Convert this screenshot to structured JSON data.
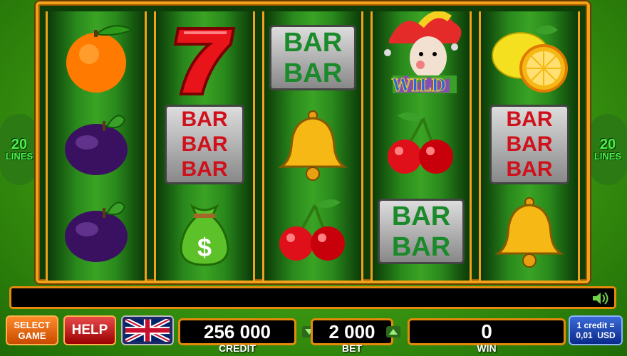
{
  "side_panel": {
    "lines_count": "20",
    "lines_label": "LINES"
  },
  "reels": [
    [
      "orange",
      "plum",
      "plum"
    ],
    [
      "seven",
      "bar3",
      "money-bag"
    ],
    [
      "bar2",
      "bell",
      "cherry"
    ],
    [
      "joker-wild",
      "cherry",
      "bar2"
    ],
    [
      "lemon",
      "bar3",
      "bell"
    ]
  ],
  "symbol_text": {
    "bar": "BAR",
    "wild": "WILD",
    "money": "$"
  },
  "controls": {
    "select_game_line1": "SELECT",
    "select_game_line2": "GAME",
    "help": "HELP",
    "credit_value": "256 000",
    "credit_label": "CREDIT",
    "bet_value": "2 000",
    "bet_label": "BET",
    "win_value": "0",
    "win_label": "WIN",
    "rate_line1": "1 credit =",
    "rate_line2": "0,01  USD"
  },
  "colors": {
    "frame": "#f0a21a",
    "reel_green": "#3aa324",
    "button_orange": "#e86a10",
    "button_red": "#c21818",
    "rate_blue": "#1a4fb0"
  },
  "icons": [
    "speaker-icon",
    "flag-uk-icon",
    "bet-decrease-icon",
    "bet-increase-icon"
  ]
}
